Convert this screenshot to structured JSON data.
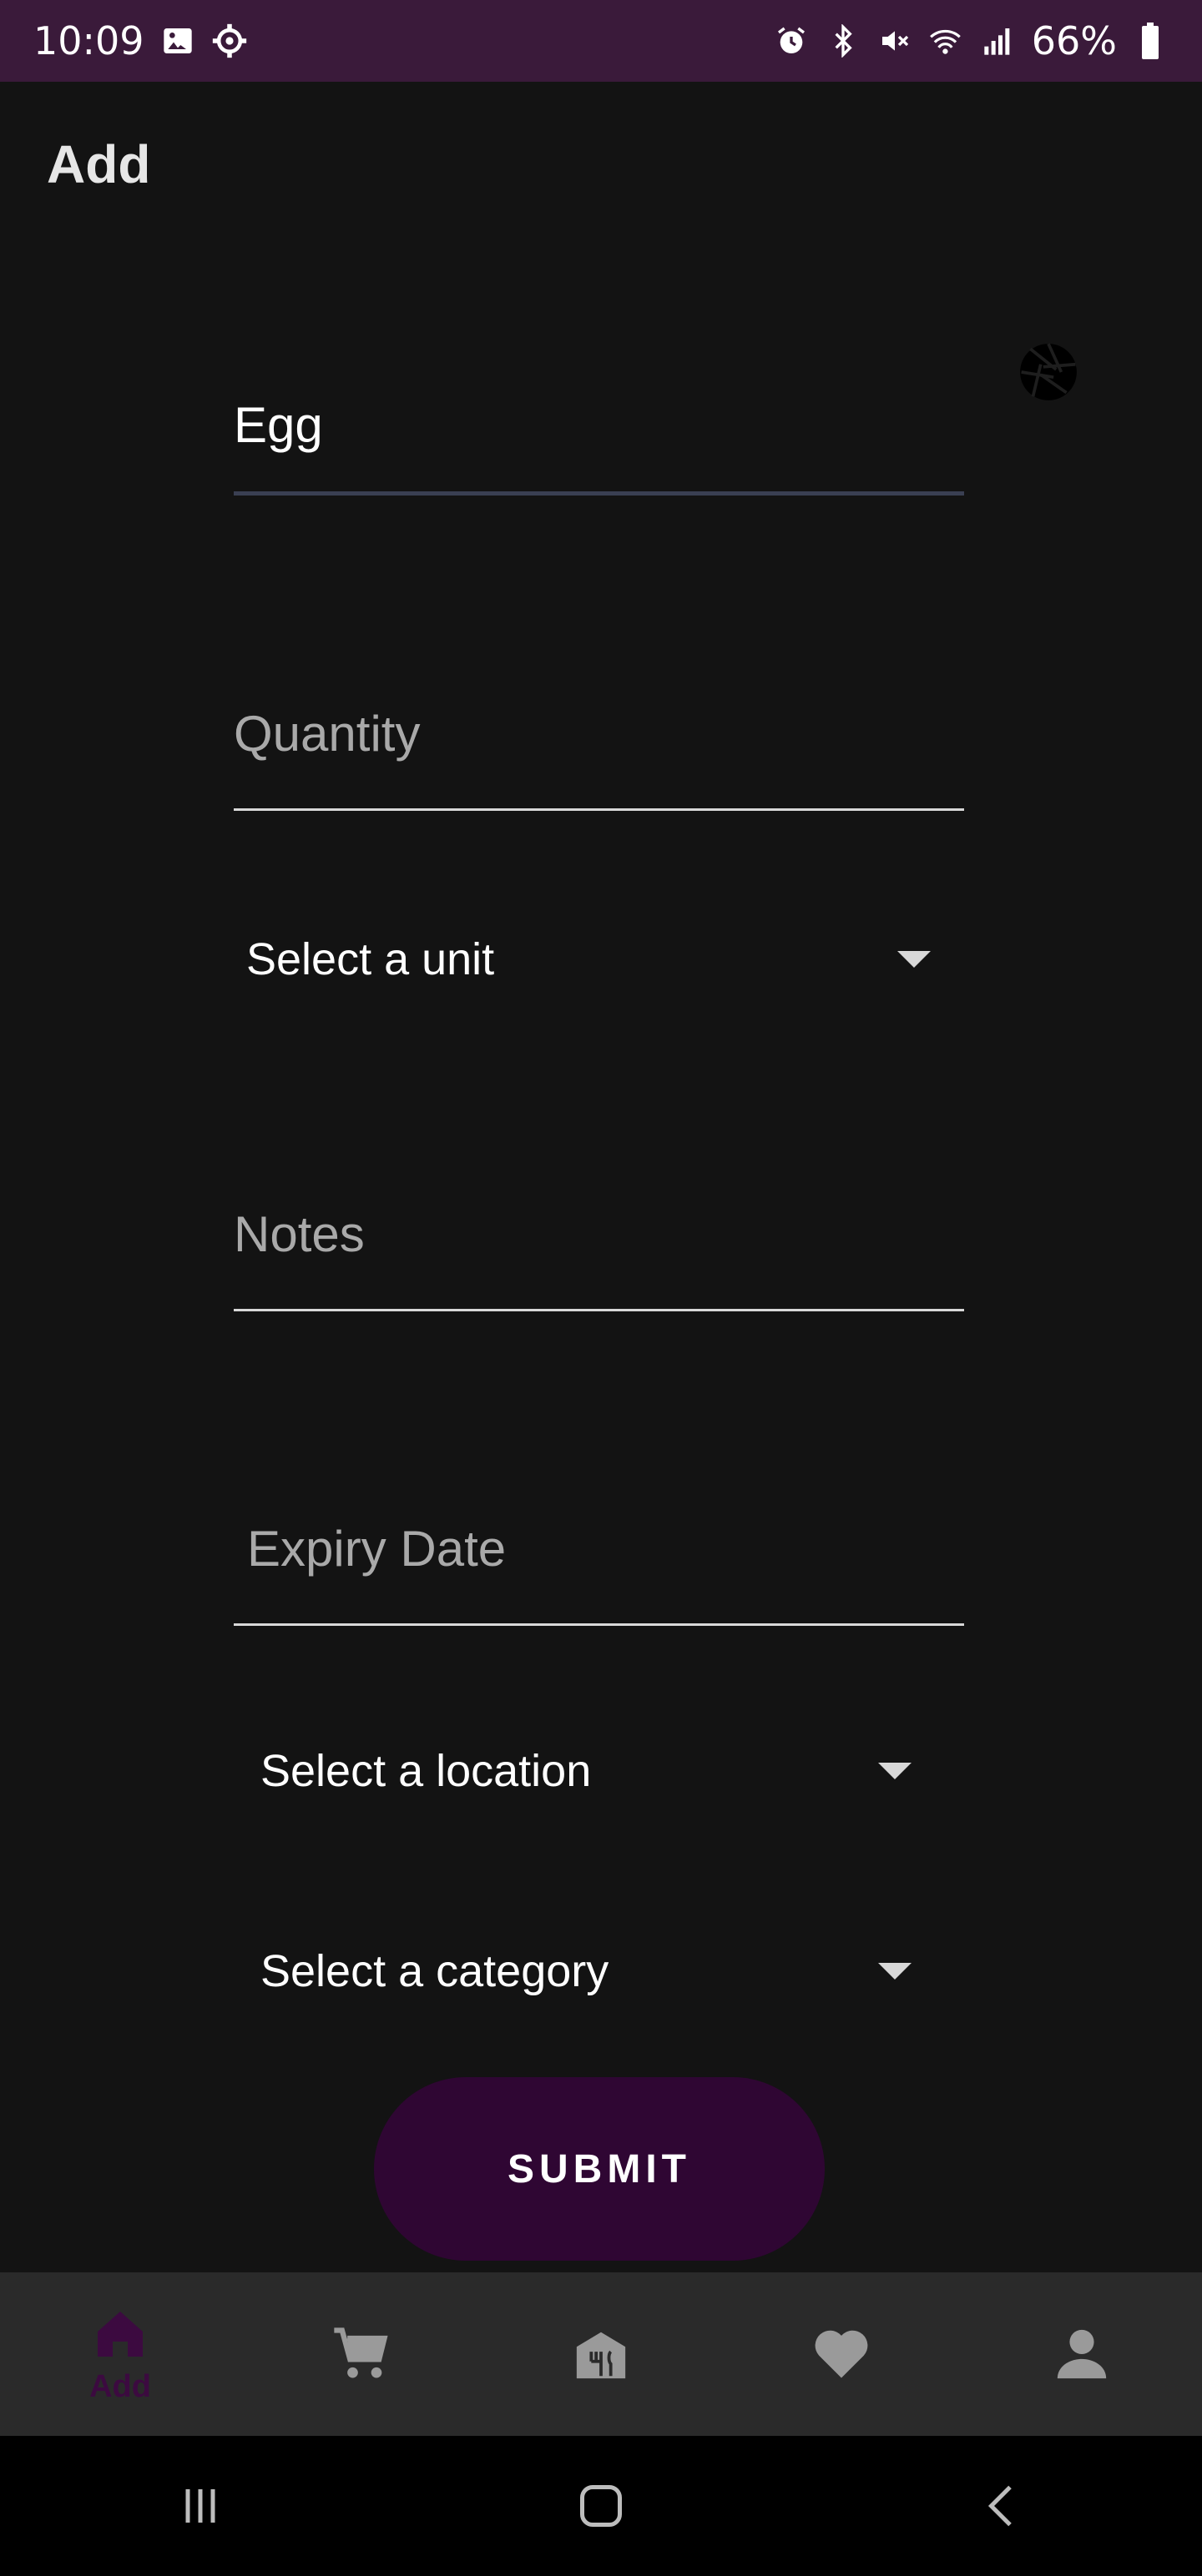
{
  "status_bar": {
    "time": "10:09",
    "battery": "66%",
    "icons": [
      "image-icon",
      "settings-icon",
      "alarm-icon",
      "bluetooth-icon",
      "mute-icon",
      "wifi-icon",
      "signal-icon",
      "battery-icon"
    ]
  },
  "header": {
    "title": "Add"
  },
  "form": {
    "name_value": "Egg",
    "quantity_placeholder": "Quantity",
    "unit_label": "Select a unit",
    "notes_placeholder": "Notes",
    "expiry_placeholder": "Expiry Date",
    "location_label": "Select a location",
    "category_label": "Select a category",
    "submit_label": "SUBMIT"
  },
  "bottom_nav": {
    "items": [
      {
        "icon": "home-icon",
        "label": "Add",
        "active": true
      },
      {
        "icon": "cart-icon",
        "label": "",
        "active": false
      },
      {
        "icon": "pantry-icon",
        "label": "",
        "active": false
      },
      {
        "icon": "heart-icon",
        "label": "",
        "active": false
      },
      {
        "icon": "person-icon",
        "label": "",
        "active": false
      }
    ]
  },
  "colors": {
    "background": "#131313",
    "status_bar": "#3a1a3a",
    "accent": "#2f0633",
    "active_nav": "#3c0a40",
    "nav_bar": "#2a2a2a"
  }
}
